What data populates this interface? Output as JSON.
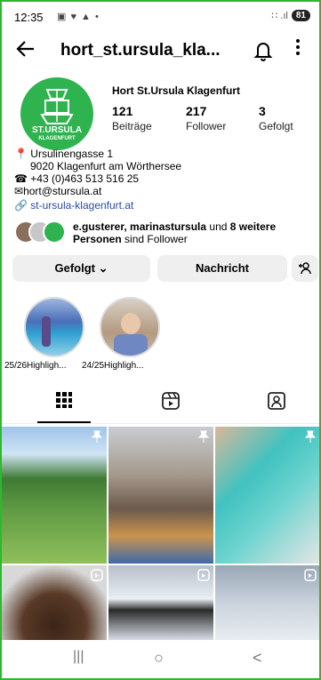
{
  "status": {
    "time": "12:35",
    "icons": "▣ ♥ ▲ •",
    "signal": "∷ .ıl",
    "battery": "81"
  },
  "header": {
    "username": "hort_st.ursula_kla...",
    "back_icon": "arrow-left-icon",
    "bell_icon": "bell-icon",
    "more_icon": "more-vertical-icon"
  },
  "profile": {
    "avatar_text_top": "ST.URSULA",
    "avatar_text_bottom": "KLAGENFURT",
    "display_name": "Hort St.Ursula Klagenfurt",
    "stats": [
      {
        "num": "121",
        "label": "Beiträge"
      },
      {
        "num": "217",
        "label": "Follower"
      },
      {
        "num": "3",
        "label": "Gefolgt"
      }
    ],
    "bio": {
      "address1": "Ursulinengasse 1",
      "address2": "9020 Klagenfurt am Wörthersee",
      "phone": "+43 (0)463 513 516 25",
      "email": "hort@stursula.at",
      "website": "st-ursula-klagenfurt.at"
    },
    "followed_by": {
      "names": "e.gusterer, marinastursula",
      "middle": " und ",
      "more": "8 weitere",
      "rest": "Personen",
      "suffix": " sind Follower"
    }
  },
  "actions": {
    "following": "Gefolgt",
    "message": "Nachricht"
  },
  "highlights": [
    {
      "label": "25/26Highligh..."
    },
    {
      "label": "24/25Highligh..."
    }
  ],
  "tabs": [
    "grid-icon",
    "reels-icon",
    "tagged-icon"
  ],
  "grid_badges": [
    "pin-icon",
    "pin-icon",
    "pin-icon",
    "reel-icon",
    "reel-icon",
    "reel-icon"
  ],
  "nav": {
    "recent": "|||",
    "home": "○",
    "back": "<"
  }
}
